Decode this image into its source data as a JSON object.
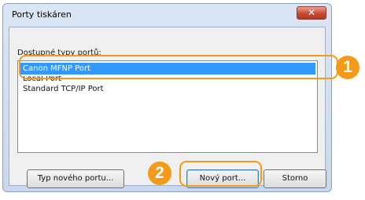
{
  "window": {
    "title": "Porty tiskáren",
    "close_glyph": "✕"
  },
  "dialog": {
    "available_types_label": "Dostupné typy portů:",
    "port_types": [
      {
        "label": "Canon MFNP Port",
        "selected": true
      },
      {
        "label": "Local Port",
        "selected": false
      },
      {
        "label": "Standard TCP/IP Port",
        "selected": false
      }
    ]
  },
  "buttons": {
    "new_port_type": "Typ nového portu...",
    "new_port": "Nový port...",
    "cancel": "Storno"
  },
  "callouts": {
    "step1": "1",
    "step2": "2",
    "color": "#f39a1a"
  }
}
